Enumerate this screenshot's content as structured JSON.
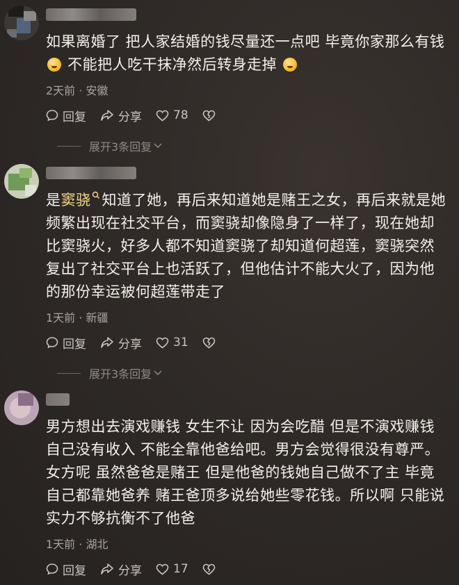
{
  "comments": [
    {
      "text_before": "如果离婚了 把人家结婚的钱尽量还一点吧 毕竟你家那么有钱",
      "text_after": " 不能把人吃干抹净然后转身走掉",
      "meta": "2天前 · 安徽",
      "reply_label": "回复",
      "share_label": "分享",
      "like_count": "78",
      "expand_label": "展开3条回复"
    },
    {
      "mention": "窦骁",
      "text": "知道了她，再后来知道她是赌王之女，再后来就是她频繁出现在社交平台，而窦骁却像隐身了一样了，现在她却比窦骁火，好多人都不知道窦骁了却知道何超莲，窦骁突然复出了社交平台上也活跃了，但他估计不能大火了，因为他的那份幸运被何超莲带走了",
      "text_prefix": "是",
      "meta": "1天前 · 新疆",
      "reply_label": "回复",
      "share_label": "分享",
      "like_count": "31",
      "expand_label": "展开3条回复"
    },
    {
      "text": "男方想出去演戏赚钱 女生不让 因为会吃醋 但是不演戏赚钱 自己没有收入 不能全靠他爸给吧。男方会觉得很没有尊严。女方呢 虽然爸爸是赌王 但是他爸的钱她自己做不了主 毕竟自己都靠她爸养 赌王爸顶多说给她些零花钱。所以啊 只能说实力不够抗衡不了他爸",
      "meta": "1天前 · 湖北",
      "reply_label": "回复",
      "share_label": "分享",
      "like_count": "17"
    }
  ],
  "colors": {
    "background": "#2e2926",
    "text": "#f4f0eb",
    "meta": "#a9a4a0",
    "mention": "#f6d98a"
  },
  "icons": [
    "reply-icon",
    "share-icon",
    "heart-icon",
    "broken-heart-icon",
    "chevron-down-icon",
    "search-mention-icon",
    "emoji-icon"
  ]
}
